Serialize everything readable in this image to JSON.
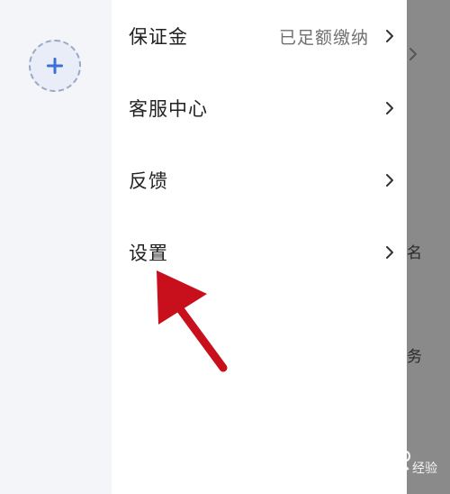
{
  "menu": {
    "items": [
      {
        "label": "保证金",
        "value": "已足额缴纳"
      },
      {
        "label": "客服中心"
      },
      {
        "label": "反馈"
      },
      {
        "label": "设置"
      }
    ]
  },
  "background_peek": {
    "items": [
      "名",
      "务"
    ]
  },
  "icons": {
    "add": "plus-icon",
    "chevron": "chevron-right-icon",
    "annotation": "red-arrow-annotation"
  },
  "watermark": {
    "brand": "Bai du 经验"
  },
  "colors": {
    "accent": "#3a6fd8",
    "annotation": "#c8101c",
    "overlay": "#8a8a8a"
  }
}
